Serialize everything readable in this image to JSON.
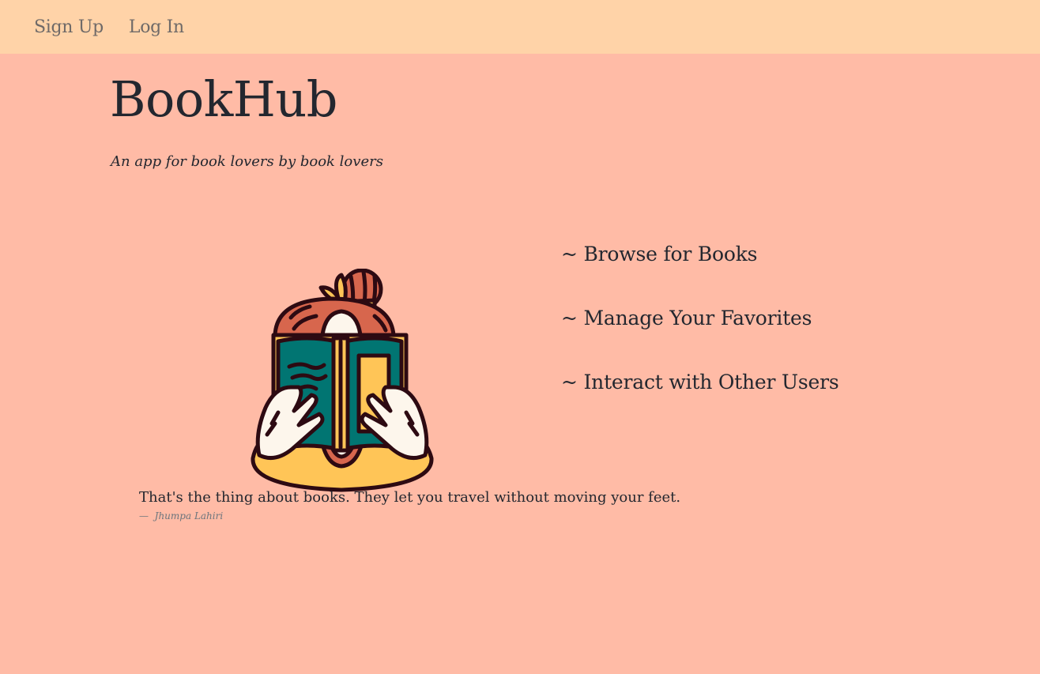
{
  "nav": {
    "links": [
      {
        "label": "Sign Up"
      },
      {
        "label": "Log In"
      }
    ]
  },
  "hero": {
    "title": "BookHub",
    "tagline": "An app for book lovers by book lovers"
  },
  "illustration": {
    "icon": "person-reading-book-illustration",
    "colors": {
      "hair": "#d7664d",
      "book_cover": "#017572",
      "book_pages": "#ffc557",
      "skin": "#fdf6ec",
      "shirt": "#ffc557",
      "outline": "#2d0a12"
    }
  },
  "features": {
    "items": [
      {
        "label": "~ Browse for Books"
      },
      {
        "label": "~ Manage Your Favorites"
      },
      {
        "label": "~ Interact with Other Users"
      }
    ]
  },
  "quote": {
    "text": "That's the thing about books. They let you travel without moving your feet.",
    "dash": "—",
    "author": "Jhumpa Lahiri"
  },
  "colors": {
    "page_background": "#ffbba6",
    "navbar_background": "#ffd3a8",
    "nav_link": "#6f6a68",
    "text": "#23272f",
    "muted": "#6c757d"
  }
}
